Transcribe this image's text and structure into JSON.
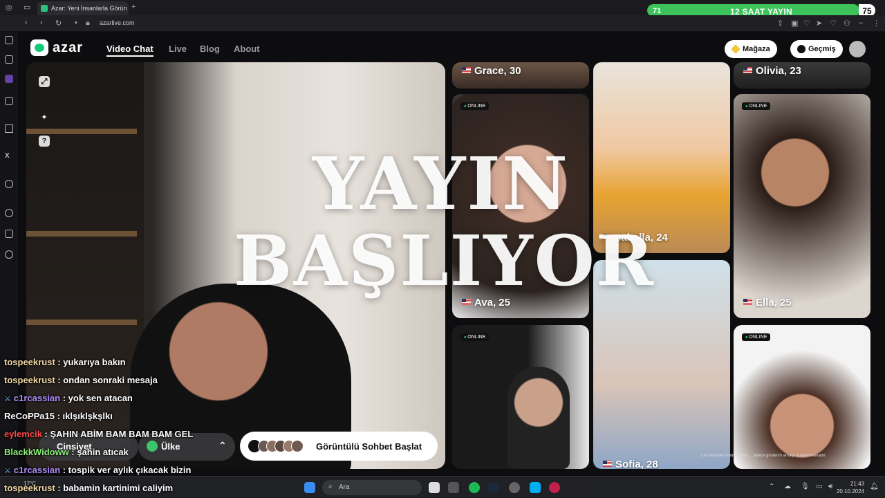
{
  "browser": {
    "tab_title": "Azar: Yeni İnsanlarla Görün",
    "url": "azarlive.com"
  },
  "stream_bar": {
    "start": "71",
    "label": "12 SAAT YAYIN",
    "end": "75",
    "progress": 0.93
  },
  "site": {
    "logo": "azar",
    "nav": [
      {
        "label": "Video Chat"
      },
      {
        "label": "Live"
      },
      {
        "label": "Blog"
      },
      {
        "label": "About"
      }
    ],
    "shop_label": "Mağaza",
    "history_label": "Geçmiş"
  },
  "overlay": {
    "line1": "YAYIN",
    "line2": "BAŞLIYOR"
  },
  "cards": [
    {
      "name": "Grace, 30",
      "online": ""
    },
    {
      "name": "Ava, 25",
      "online": "ONLINE"
    },
    {
      "name": "",
      "online": "ONLINE"
    },
    {
      "name": "sabella, 24",
      "online": ""
    },
    {
      "name": "Sofia, 28",
      "online": ""
    },
    {
      "name": "Olivia, 23",
      "online": ""
    },
    {
      "name": "Ella, 25",
      "online": "ONLINE"
    },
    {
      "name": "",
      "online": "ONLINE"
    }
  ],
  "controls": {
    "gender_label": "Cinsiyet",
    "country_label": "Ülke",
    "start_label": "Görüntülü Sohbet Başlat"
  },
  "disclaimer": "Tüm resimler modellerden ... adece gösterim amaçlı kullanılmaktadır",
  "chat": [
    {
      "user": "tospeekrust",
      "msg": " : yukarıya bakın",
      "color": "#f3d9a4"
    },
    {
      "user": "tospeekrust",
      "msg": " : ondan sonraki mesaja",
      "color": "#f3d9a4"
    },
    {
      "user": "c1rcassian",
      "msg": " : yok sen atacan",
      "color": "#b28cff"
    },
    {
      "user": "ReCoPPa15",
      "msg": " : ıklşıklşkşlkı",
      "color": "#ffffff"
    },
    {
      "user": "eylemcik",
      "msg": " : ŞAHIN ABİM BAM BAM BAM GEL",
      "color": "#ff4b4b"
    },
    {
      "user": "BlackkWidoww",
      "msg": " : şahin atıcak",
      "color": "#8ef07a"
    },
    {
      "user": "c1rcassian",
      "msg": " : tospik ver aylık çıkacak bizin",
      "color": "#b28cff"
    },
    {
      "user": "tospeekrust",
      "msg": " : babamin kartinimi caliyim",
      "color": "#f3d9a4"
    }
  ],
  "taskbar": {
    "search_placeholder": "Ara",
    "weather": "17°C",
    "time": "21:43",
    "date": "20.10.2024"
  },
  "colors": {
    "progress_green": "#3cc45a",
    "azar_green": "#12c97a",
    "online_dot": "#3ee06a"
  }
}
